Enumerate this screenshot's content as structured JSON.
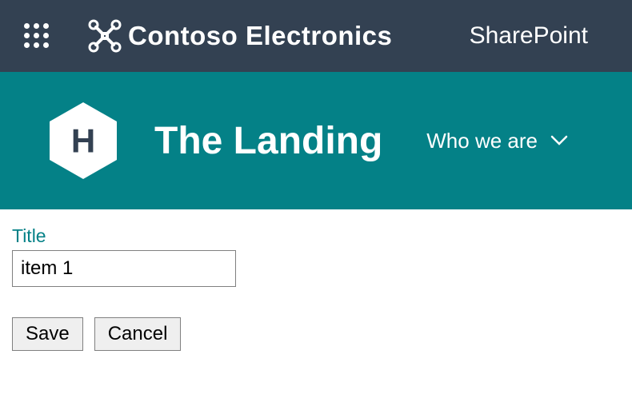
{
  "topBar": {
    "brandName": "Contoso Electronics",
    "appName": "SharePoint"
  },
  "siteHeader": {
    "siteLetter": "H",
    "siteTitle": "The Landing",
    "navItem": "Who we are"
  },
  "form": {
    "titleLabel": "Title",
    "titleValue": "item 1",
    "saveLabel": "Save",
    "cancelLabel": "Cancel"
  }
}
